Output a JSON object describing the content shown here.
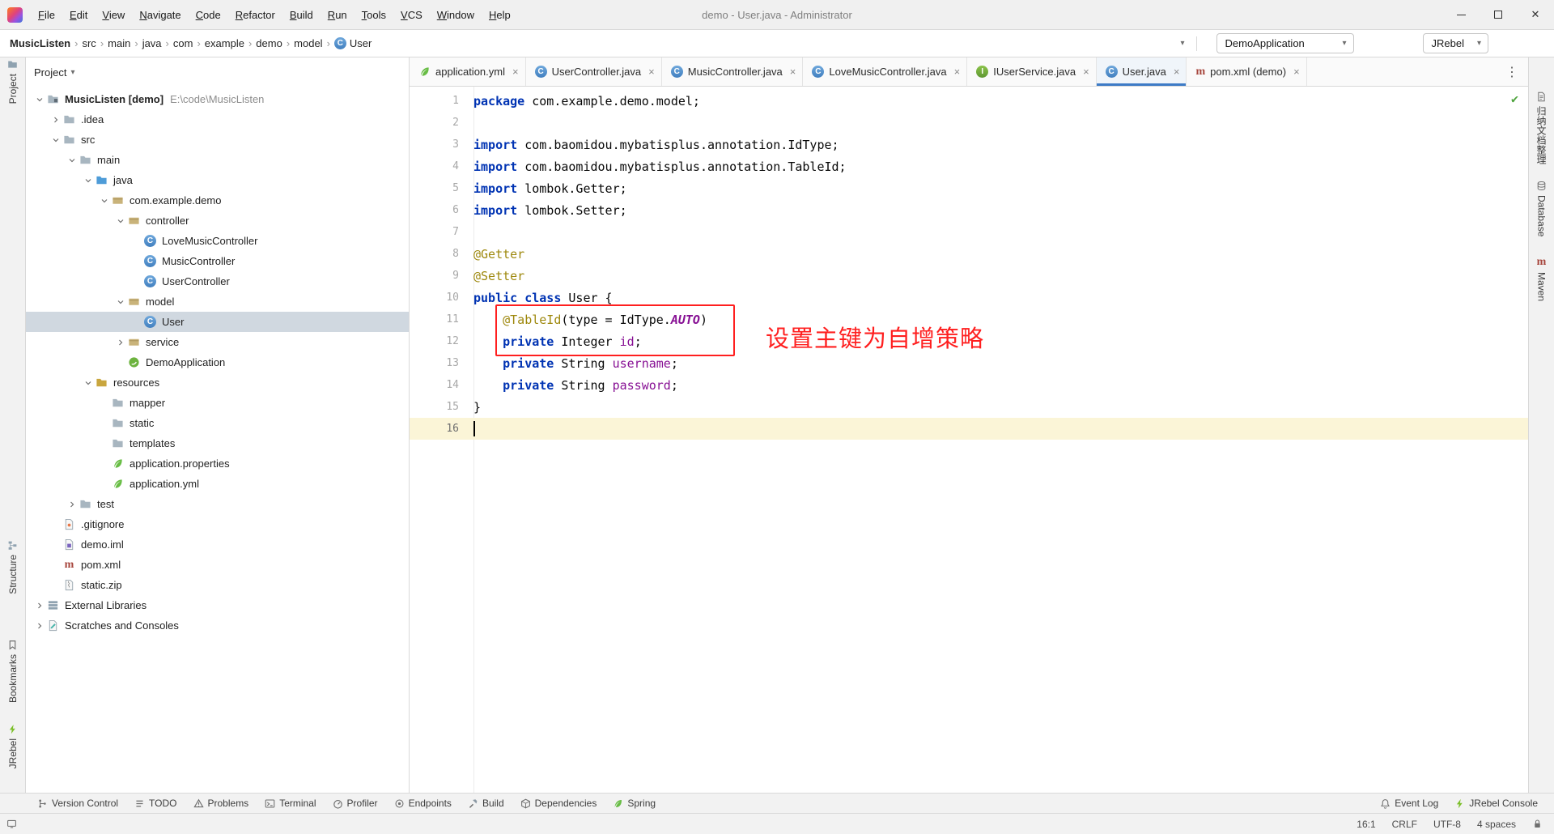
{
  "window": {
    "title": "demo - User.java - Administrator"
  },
  "menu_bar": [
    "File",
    "Edit",
    "View",
    "Navigate",
    "Code",
    "Refactor",
    "Build",
    "Run",
    "Tools",
    "VCS",
    "Window",
    "Help"
  ],
  "navbar": {
    "breadcrumbs": [
      {
        "label": "MusicListen",
        "bold": true
      },
      {
        "label": "src"
      },
      {
        "label": "main"
      },
      {
        "label": "java"
      },
      {
        "label": "com"
      },
      {
        "label": "example"
      },
      {
        "label": "demo"
      },
      {
        "label": "model"
      },
      {
        "label": "User",
        "icon": "class"
      }
    ],
    "run_config": "DemoApplication",
    "jrebel_label": "JRebel",
    "toolbar": {
      "left": [
        "user-avatar",
        "build-hammer"
      ],
      "run_group": [
        "run-play",
        "debug-bug",
        "coverage-shield",
        "profiler-gauge",
        "jrebel-run",
        "jrebel-debug"
      ],
      "right_group": [
        "edit-disabled",
        "stop-disabled",
        "search",
        "updates",
        "plugin-sphere"
      ]
    }
  },
  "project": {
    "header": {
      "title": "Project",
      "icons": [
        "locate-target",
        "collapse-all",
        "settings-gear",
        "hide-panel"
      ]
    },
    "tree": [
      {
        "label": "MusicListen [demo]",
        "hint": "E:\\code\\MusicListen",
        "depth": 0,
        "icon": "folder-project",
        "chevron": "down",
        "bold": true
      },
      {
        "label": ".idea",
        "depth": 1,
        "icon": "folder",
        "chevron": "right"
      },
      {
        "label": "src",
        "depth": 1,
        "icon": "folder",
        "chevron": "down"
      },
      {
        "label": "main",
        "depth": 2,
        "icon": "folder",
        "chevron": "down"
      },
      {
        "label": "java",
        "depth": 3,
        "icon": "folder-src",
        "chevron": "down"
      },
      {
        "label": "com.example.demo",
        "depth": 4,
        "icon": "package",
        "chevron": "down"
      },
      {
        "label": "controller",
        "depth": 5,
        "icon": "package",
        "chevron": "down"
      },
      {
        "label": "LoveMusicController",
        "depth": 6,
        "icon": "class"
      },
      {
        "label": "MusicController",
        "depth": 6,
        "icon": "class"
      },
      {
        "label": "UserController",
        "depth": 6,
        "icon": "class"
      },
      {
        "label": "model",
        "depth": 5,
        "icon": "package",
        "chevron": "down"
      },
      {
        "label": "User",
        "depth": 6,
        "icon": "class",
        "selected": true
      },
      {
        "label": "service",
        "depth": 5,
        "icon": "package",
        "chevron": "right"
      },
      {
        "label": "DemoApplication",
        "depth": 5,
        "icon": "boot"
      },
      {
        "label": "resources",
        "depth": 3,
        "icon": "folder-res",
        "chevron": "down"
      },
      {
        "label": "mapper",
        "depth": 4,
        "icon": "folder"
      },
      {
        "label": "static",
        "depth": 4,
        "icon": "folder"
      },
      {
        "label": "templates",
        "depth": 4,
        "icon": "folder"
      },
      {
        "label": "application.properties",
        "depth": 4,
        "icon": "spring-file"
      },
      {
        "label": "application.yml",
        "depth": 4,
        "icon": "spring-file"
      },
      {
        "label": "test",
        "depth": 2,
        "icon": "folder",
        "chevron": "right"
      },
      {
        "label": ".gitignore",
        "depth": 1,
        "icon": "file-git"
      },
      {
        "label": "demo.iml",
        "depth": 1,
        "icon": "file-iml"
      },
      {
        "label": "pom.xml",
        "depth": 1,
        "icon": "maven"
      },
      {
        "label": "static.zip",
        "depth": 1,
        "icon": "file-zip"
      },
      {
        "label": "External Libraries",
        "depth": 0,
        "icon": "lib",
        "chevron": "right"
      },
      {
        "label": "Scratches and Consoles",
        "depth": 0,
        "icon": "scratch",
        "chevron": "right"
      }
    ]
  },
  "editor": {
    "tabs": [
      {
        "label": "application.yml",
        "icon": "spring-file"
      },
      {
        "label": "UserController.java",
        "icon": "class"
      },
      {
        "label": "MusicController.java",
        "icon": "class"
      },
      {
        "label": "LoveMusicController.java",
        "icon": "class"
      },
      {
        "label": "IUserService.java",
        "icon": "interface"
      },
      {
        "label": "User.java",
        "icon": "class",
        "active": true
      },
      {
        "label": "pom.xml (demo)",
        "icon": "maven"
      }
    ],
    "lines": [
      {
        "n": 1,
        "seg": [
          [
            "kw",
            "package"
          ],
          [
            "pl",
            " com.example.demo.model;"
          ]
        ]
      },
      {
        "n": 2,
        "seg": []
      },
      {
        "n": 3,
        "seg": [
          [
            "kw",
            "import"
          ],
          [
            "pl",
            " com.baomidou.mybatisplus.annotation.IdType;"
          ]
        ]
      },
      {
        "n": 4,
        "seg": [
          [
            "kw",
            "import"
          ],
          [
            "pl",
            " com.baomidou.mybatisplus.annotation.TableId;"
          ]
        ]
      },
      {
        "n": 5,
        "seg": [
          [
            "kw",
            "import"
          ],
          [
            "pl",
            " lombok.Getter;"
          ]
        ]
      },
      {
        "n": 6,
        "seg": [
          [
            "kw",
            "import"
          ],
          [
            "pl",
            " lombok.Setter;"
          ]
        ]
      },
      {
        "n": 7,
        "seg": []
      },
      {
        "n": 8,
        "seg": [
          [
            "ann",
            "@Getter"
          ]
        ]
      },
      {
        "n": 9,
        "seg": [
          [
            "ann",
            "@Setter"
          ]
        ]
      },
      {
        "n": 10,
        "seg": [
          [
            "kw",
            "public"
          ],
          [
            "pl",
            " "
          ],
          [
            "kw",
            "class"
          ],
          [
            "pl",
            " User {"
          ]
        ]
      },
      {
        "n": 11,
        "seg": [
          [
            "pl",
            "    "
          ],
          [
            "ann",
            "@TableId"
          ],
          [
            "pl",
            "(type = IdType."
          ],
          [
            "enm",
            "AUTO"
          ],
          [
            "pl",
            ")"
          ]
        ]
      },
      {
        "n": 12,
        "seg": [
          [
            "pl",
            "    "
          ],
          [
            "kw",
            "private"
          ],
          [
            "pl",
            " Integer "
          ],
          [
            "fld",
            "id"
          ],
          [
            "pl",
            ";"
          ]
        ]
      },
      {
        "n": 13,
        "seg": [
          [
            "pl",
            "    "
          ],
          [
            "kw",
            "private"
          ],
          [
            "pl",
            " String "
          ],
          [
            "fld",
            "username"
          ],
          [
            "pl",
            ";"
          ]
        ]
      },
      {
        "n": 14,
        "seg": [
          [
            "pl",
            "    "
          ],
          [
            "kw",
            "private"
          ],
          [
            "pl",
            " String "
          ],
          [
            "fld",
            "password"
          ],
          [
            "pl",
            ";"
          ]
        ]
      },
      {
        "n": 15,
        "seg": [
          [
            "pl",
            "}"
          ]
        ]
      },
      {
        "n": 16,
        "seg": [],
        "caret": true
      }
    ],
    "annotation": {
      "text": "设置主键为自增策略"
    },
    "inspection_check": "✔"
  },
  "tool_strips": {
    "left": [
      {
        "id": "project",
        "label": "Project"
      },
      {
        "id": "structure",
        "label": "Structure"
      },
      {
        "id": "bookmarks",
        "label": "Bookmarks"
      },
      {
        "id": "jrebel",
        "label": "JRebel"
      }
    ],
    "right": [
      {
        "id": "docs",
        "label": "归纳文档整理"
      },
      {
        "id": "database",
        "label": "Database"
      },
      {
        "id": "maven",
        "label": "Maven"
      }
    ]
  },
  "bottom": {
    "tools": [
      {
        "id": "version-control",
        "label": "Version Control",
        "icon": "branch"
      },
      {
        "id": "todo",
        "label": "TODO",
        "icon": "todo-list"
      },
      {
        "id": "problems",
        "label": "Problems",
        "icon": "problems"
      },
      {
        "id": "terminal",
        "label": "Terminal",
        "icon": "terminal"
      },
      {
        "id": "profiler",
        "label": "Profiler",
        "icon": "profiler"
      },
      {
        "id": "endpoints",
        "label": "Endpoints",
        "icon": "endpoints"
      },
      {
        "id": "build",
        "label": "Build",
        "icon": "build"
      },
      {
        "id": "dependencies",
        "label": "Dependencies",
        "icon": "dependencies"
      },
      {
        "id": "spring",
        "label": "Spring",
        "icon": "spring"
      }
    ],
    "tools_right": [
      {
        "id": "event-log",
        "label": "Event Log",
        "icon": "event-log"
      },
      {
        "id": "jrebel-console",
        "label": "JRebel Console",
        "icon": "jrebel-console"
      }
    ],
    "status": {
      "caret_position": "16:1",
      "line_separator": "CRLF",
      "encoding": "UTF-8",
      "indent": "4 spaces"
    }
  }
}
